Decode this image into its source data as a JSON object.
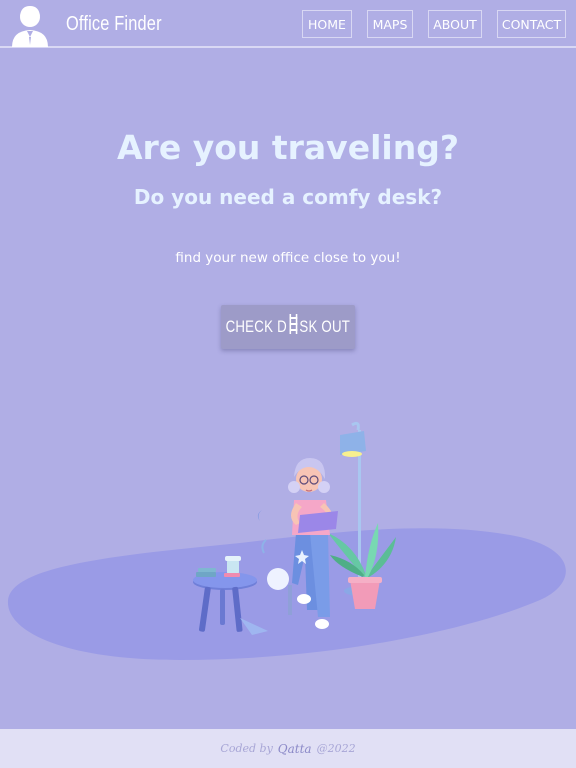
{
  "header": {
    "title": "Office Finder",
    "nav": {
      "home": "HOME",
      "maps": "MAPS",
      "about": "ABOUT",
      "contact": "CONTACT"
    }
  },
  "hero": {
    "title": "Are you traveling?",
    "subtitle": "Do you need a comfy desk?",
    "tagline": "find your new office close to you!",
    "cta_before": "CHECK D",
    "cta_after": "SK OUT",
    "cta_icon": "desk-icon"
  },
  "footer": {
    "prefix": "Coded by",
    "author": "Qatta",
    "year": "@2022"
  },
  "colors": {
    "background": "#b0aee5",
    "heading": "#e6f2ff",
    "button": "#9d9bc8",
    "footer": "#e1e0f5"
  }
}
